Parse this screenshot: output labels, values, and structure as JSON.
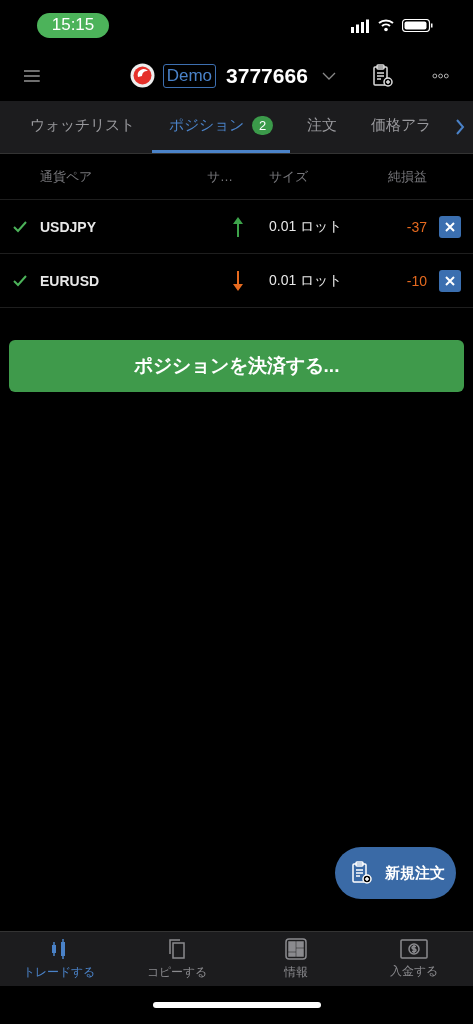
{
  "status_bar": {
    "time": "15:15"
  },
  "header": {
    "account_type": "Demo",
    "account_number": "3777666"
  },
  "tabs": [
    {
      "label": "ウォッチリスト",
      "selected": false
    },
    {
      "label": "ポジション",
      "selected": true,
      "badge": "2"
    },
    {
      "label": "注文",
      "selected": false
    },
    {
      "label": "価格アラ",
      "selected": false
    }
  ],
  "table": {
    "columns": [
      "通貨ペア",
      "サ…",
      "サイズ",
      "純損益"
    ],
    "rows": [
      {
        "checked": true,
        "symbol": "USDJPY",
        "kind": "buy",
        "size": "0.01 ロット",
        "pnl": "-37"
      },
      {
        "checked": true,
        "symbol": "EURUSD",
        "kind": "sell",
        "size": "0.01 ロット",
        "pnl": "-10"
      }
    ]
  },
  "close_all_button": "ポジションを決済する...",
  "new_order_button": "新規注文",
  "bottom_nav": [
    {
      "label": "トレードする",
      "selected": true,
      "kind": "trade"
    },
    {
      "label": "コピーする",
      "selected": false,
      "kind": "copy"
    },
    {
      "label": "情報",
      "selected": false,
      "kind": "info"
    },
    {
      "label": "入金する",
      "selected": false,
      "kind": "deposit"
    }
  ]
}
